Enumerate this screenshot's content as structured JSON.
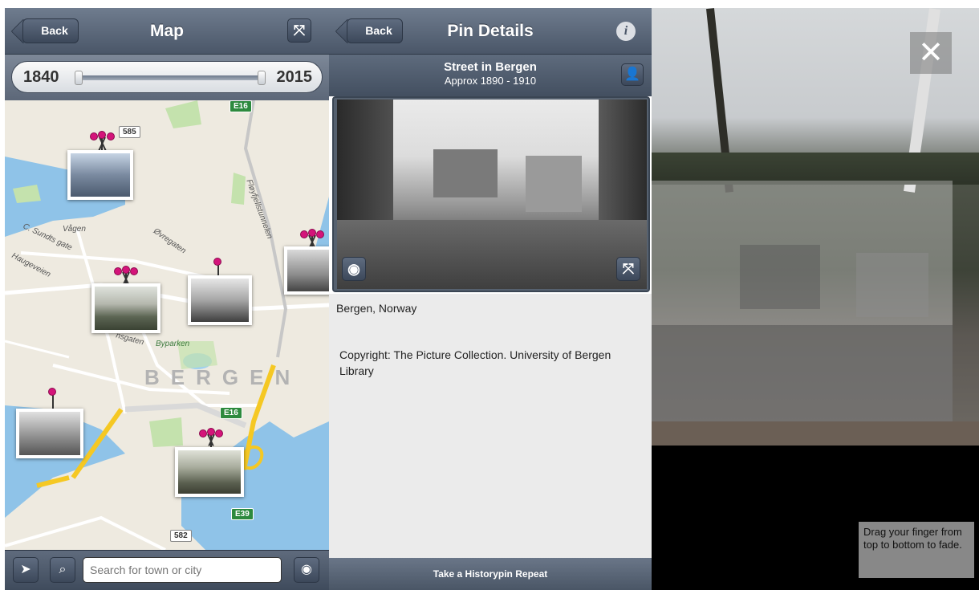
{
  "map_screen": {
    "back_label": "Back",
    "title": "Map",
    "expand_icon": "expand-icon",
    "timeline": {
      "start_year": "1840",
      "end_year": "2015",
      "range_start_fraction": 0.0,
      "range_end_fraction": 1.0
    },
    "map": {
      "city_label": "BERGEN",
      "road_labels": {
        "vagen": "Vågen",
        "c_sundts_gate": "C. Sundts gate",
        "haugeveien": "Haugeveien",
        "ovregaten": "Øvregaten",
        "floyfjellstunnelen": "Fløyfjellstunnelen",
        "byparken": "Byparken",
        "nsgaten": "nsgaten"
      },
      "shields": {
        "e16_top": "E16",
        "e16_mid": "E16",
        "e39": "E39",
        "r585": "585",
        "r582": "582"
      }
    },
    "search": {
      "placeholder": "Search for town or city"
    }
  },
  "pin_screen": {
    "back_label": "Back",
    "title": "Pin Details",
    "info_icon": "info-icon",
    "pin_title": "Street in Bergen",
    "pin_date": "Approx 1890 - 1910",
    "location": "Bergen, Norway",
    "copyright": "Copyright: The Picture Collection. University of Bergen Library",
    "action_label": "Take a Historypin Repeat"
  },
  "repeat_screen": {
    "close_symbol": "✕",
    "hint": "Drag your finger from top to bottom to fade."
  },
  "colors": {
    "navbar": "#56626f",
    "pin": "#d4147a",
    "highway": "#f5c823",
    "water": "#8fc3e8",
    "park": "#c4e2ad"
  }
}
